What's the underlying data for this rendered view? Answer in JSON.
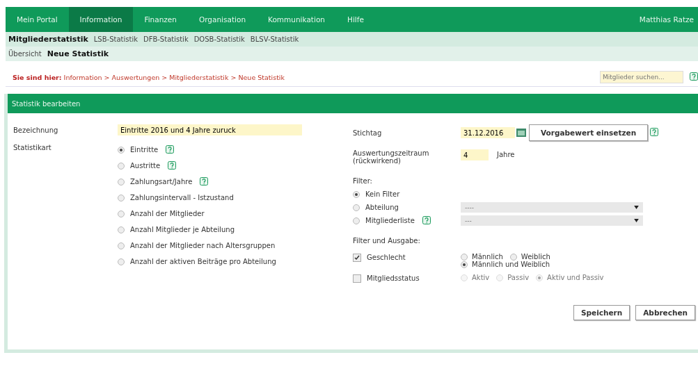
{
  "nav": {
    "items": [
      {
        "label": "Mein Portal",
        "selected": false
      },
      {
        "label": "Information",
        "selected": true
      },
      {
        "label": "Finanzen",
        "selected": false
      },
      {
        "label": "Organisation",
        "selected": false
      },
      {
        "label": "Kommunikation",
        "selected": false
      },
      {
        "label": "Hilfe",
        "selected": false
      }
    ],
    "user": "Matthias Ratze"
  },
  "subtabs": [
    {
      "label": "Mitgliederstatistik",
      "selected": true
    },
    {
      "label": "LSB-Statistik",
      "selected": false
    },
    {
      "label": "DFB-Statistik",
      "selected": false
    },
    {
      "label": "DOSB-Statistik",
      "selected": false
    },
    {
      "label": "BLSV-Statistik",
      "selected": false
    }
  ],
  "subtabs2": [
    {
      "label": "Übersicht",
      "selected": false
    },
    {
      "label": "Neue Statistik",
      "selected": true
    }
  ],
  "breadcrumb": {
    "label": "Sie sind hier:",
    "path": "Information > Auswertungen > Mitgliederstatistik > Neue Statistik"
  },
  "search": {
    "placeholder": "Mitglieder suchen..."
  },
  "panel": {
    "title": "Statistik bearbeiten",
    "bezeichnung": {
      "label": "Bezeichnung",
      "value": "Eintritte 2016 und 4 Jahre zuruck"
    },
    "statistikart": {
      "label": "Statistikart",
      "options": [
        {
          "label": "Eintritte",
          "selected": true,
          "help": true
        },
        {
          "label": "Austritte",
          "selected": false,
          "help": true
        },
        {
          "label": "Zahlungsart/Jahre",
          "selected": false,
          "help": true
        },
        {
          "label": "Zahlungsintervall - Istzustand",
          "selected": false,
          "help": false
        },
        {
          "label": "Anzahl der Mitglieder",
          "selected": false,
          "help": false
        },
        {
          "label": "Anzahl Mitglieder je Abteilung",
          "selected": false,
          "help": false
        },
        {
          "label": "Anzahl der Mitglieder nach Altersgruppen",
          "selected": false,
          "help": false
        },
        {
          "label": "Anzahl der aktiven Beiträge pro Abteilung",
          "selected": false,
          "help": false
        }
      ]
    },
    "stichtag": {
      "label": "Stichtag",
      "value": "31.12.2016",
      "button": "Vorgabewert einsetzen"
    },
    "zeitraum": {
      "label": "Auswertungszeitraum (rückwirkend)",
      "value": "4",
      "unit": "Jahre"
    },
    "filter": {
      "label": "Filter:",
      "options": [
        {
          "label": "Kein Filter",
          "selected": true,
          "help": false
        },
        {
          "label": "Abteilung",
          "selected": false,
          "help": false,
          "select": "----"
        },
        {
          "label": "Mitgliederliste",
          "selected": false,
          "help": true,
          "select": "---"
        }
      ]
    },
    "ausgabe": {
      "label": "Filter und Ausgabe:",
      "rows": [
        {
          "label": "Geschlecht",
          "checked": true,
          "options": [
            {
              "label": "Männlich",
              "selected": false
            },
            {
              "label": "Weiblich",
              "selected": false
            },
            {
              "label": "Männlich und Weiblich",
              "selected": true
            }
          ]
        },
        {
          "label": "Mitgliedsstatus",
          "checked": false,
          "options": [
            {
              "label": "Aktiv",
              "selected": false
            },
            {
              "label": "Passiv",
              "selected": false
            },
            {
              "label": "Aktiv und Passiv",
              "selected": true
            }
          ]
        }
      ]
    },
    "buttons": [
      "Speichern",
      "Abbrechen"
    ]
  }
}
